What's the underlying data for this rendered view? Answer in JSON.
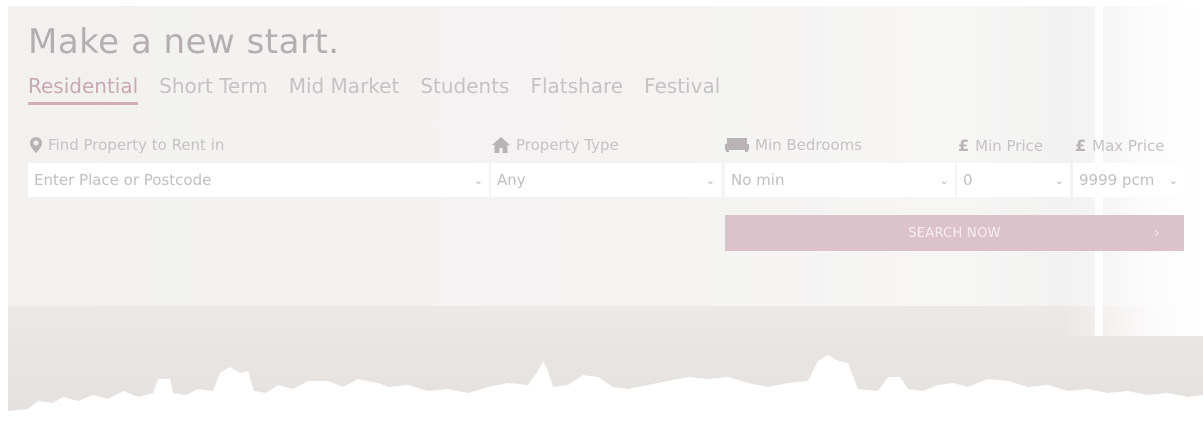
{
  "hero": {
    "title": "Make a new start."
  },
  "tabs": [
    {
      "label": "Residential",
      "active": true
    },
    {
      "label": "Short Term"
    },
    {
      "label": "Mid Market"
    },
    {
      "label": "Students"
    },
    {
      "label": "Flatshare"
    },
    {
      "label": "Festival"
    }
  ],
  "form": {
    "location": {
      "label": "Find Property to Rent in",
      "icon": "map-marker-icon",
      "placeholder": "Enter Place or Postcode"
    },
    "type": {
      "label": "Property Type",
      "icon": "house-icon",
      "value": "Any"
    },
    "bedrooms": {
      "label": "Min Bedrooms",
      "icon": "bed-icon",
      "value": "No min"
    },
    "min_price": {
      "label": "Min Price",
      "icon": "pound-icon",
      "currency": "£",
      "value": "0"
    },
    "max_price": {
      "label": "Max Price",
      "icon": "pound-icon",
      "currency": "£",
      "value": "9999 pcm"
    },
    "search_label": "SEARCH NOW",
    "search_arrow": "›"
  },
  "colors": {
    "accent": "#dcc2ca",
    "tab_active": "#c8a8b2",
    "text_muted": "#c6c1c3"
  }
}
